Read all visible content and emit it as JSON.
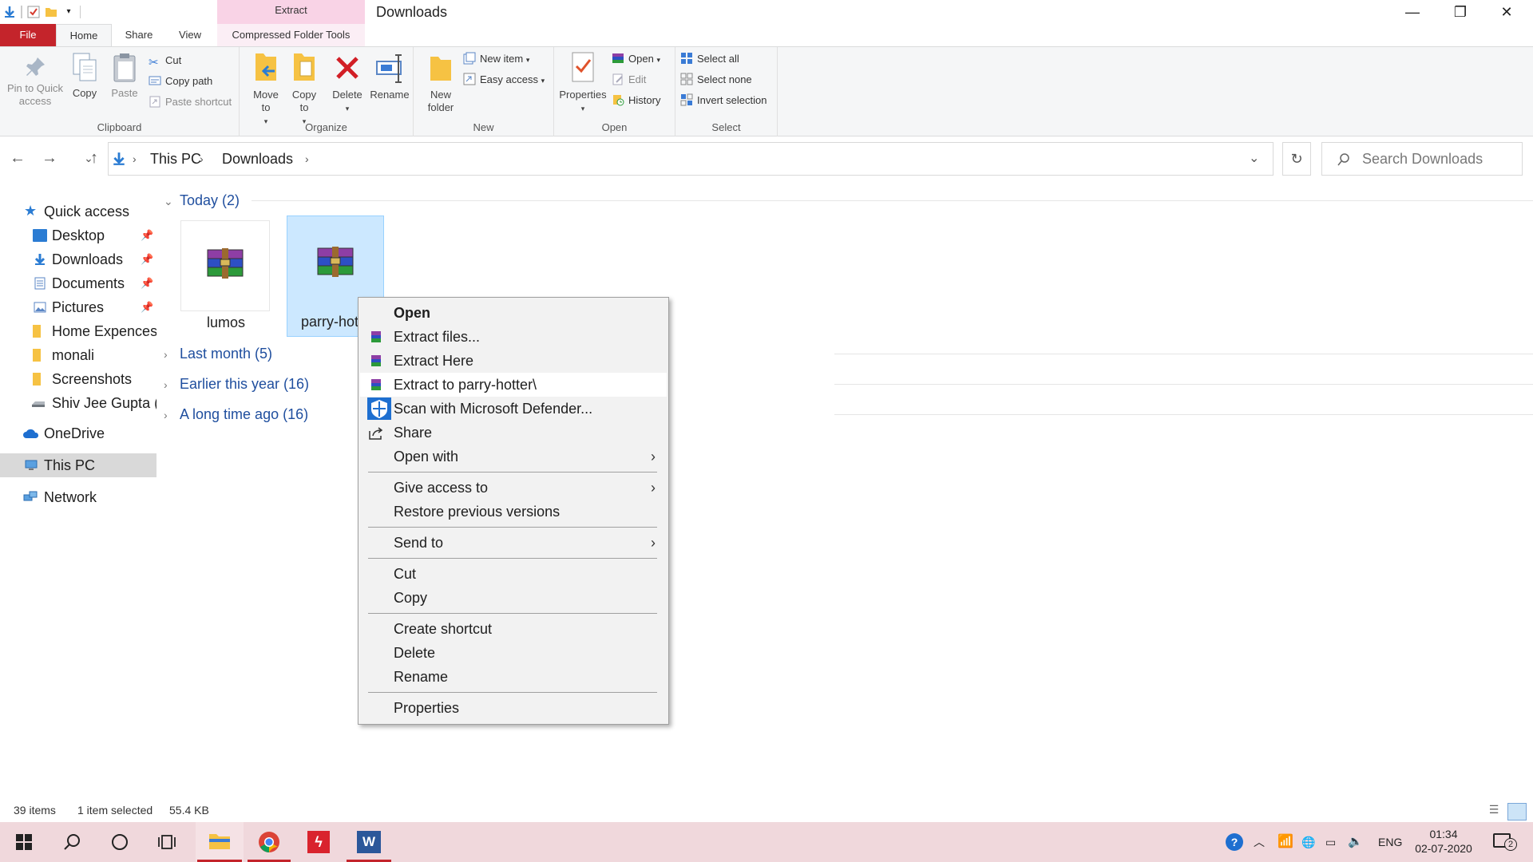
{
  "colors": {
    "accent": "#0078d7",
    "file_tab": "#c4242b",
    "extract_tab": "#f9d3e6",
    "selection": "#cce8ff",
    "link": "#1f4e9e",
    "taskbar": "#f0d8dc"
  },
  "window": {
    "title": "Downloads",
    "context_tab_group": "Extract",
    "minimize_icon": "minimize-icon",
    "maximize_icon": "restore-icon",
    "close_icon": "close-icon"
  },
  "ribbon": {
    "tabs": [
      "File",
      "Home",
      "Share",
      "View",
      "Compressed Folder Tools"
    ],
    "clipboard": {
      "pin": "Pin to Quick access",
      "copy": "Copy",
      "paste": "Paste",
      "cut": "Cut",
      "copy_path": "Copy path",
      "paste_shortcut": "Paste shortcut",
      "label": "Clipboard"
    },
    "organize": {
      "move_to": "Move to",
      "copy_to": "Copy to",
      "delete": "Delete",
      "rename": "Rename",
      "label": "Organize"
    },
    "new": {
      "new_folder": "New folder",
      "new_item": "New item",
      "easy_access": "Easy access",
      "label": "New"
    },
    "open": {
      "properties": "Properties",
      "open": "Open",
      "edit": "Edit",
      "history": "History",
      "label": "Open"
    },
    "select": {
      "select_all": "Select all",
      "select_none": "Select none",
      "invert_selection": "Invert selection",
      "label": "Select"
    }
  },
  "address": {
    "crumbs": [
      "This PC",
      "Downloads"
    ],
    "search_placeholder": "Search Downloads"
  },
  "navpane": {
    "quick_access": "Quick access",
    "items": [
      "Desktop",
      "Downloads",
      "Documents",
      "Pictures",
      "Home Expences",
      "monali",
      "Screenshots",
      "Shiv Jee Gupta (E"
    ],
    "onedrive": "OneDrive",
    "this_pc": "This PC",
    "network": "Network"
  },
  "content": {
    "groups": [
      "Today (2)",
      "Last month (5)",
      "Earlier this year (16)",
      "A long time ago (16)"
    ],
    "files": [
      "lumos",
      "parry-hotter"
    ]
  },
  "context_menu": {
    "open": "Open",
    "extract_files": "Extract files...",
    "extract_here": "Extract Here",
    "extract_to": "Extract to parry-hotter\\",
    "scan": "Scan with Microsoft Defender...",
    "share": "Share",
    "open_with": "Open with",
    "give_access": "Give access to",
    "restore": "Restore previous versions",
    "send_to": "Send to",
    "cut": "Cut",
    "copy": "Copy",
    "create_shortcut": "Create shortcut",
    "delete": "Delete",
    "rename": "Rename",
    "properties": "Properties"
  },
  "status": {
    "items": "39 items",
    "selected": "1 item selected",
    "size": "55.4 KB"
  },
  "taskbar": {
    "lang": "ENG",
    "time": "01:34",
    "date": "02-07-2020",
    "notifications": "2"
  }
}
